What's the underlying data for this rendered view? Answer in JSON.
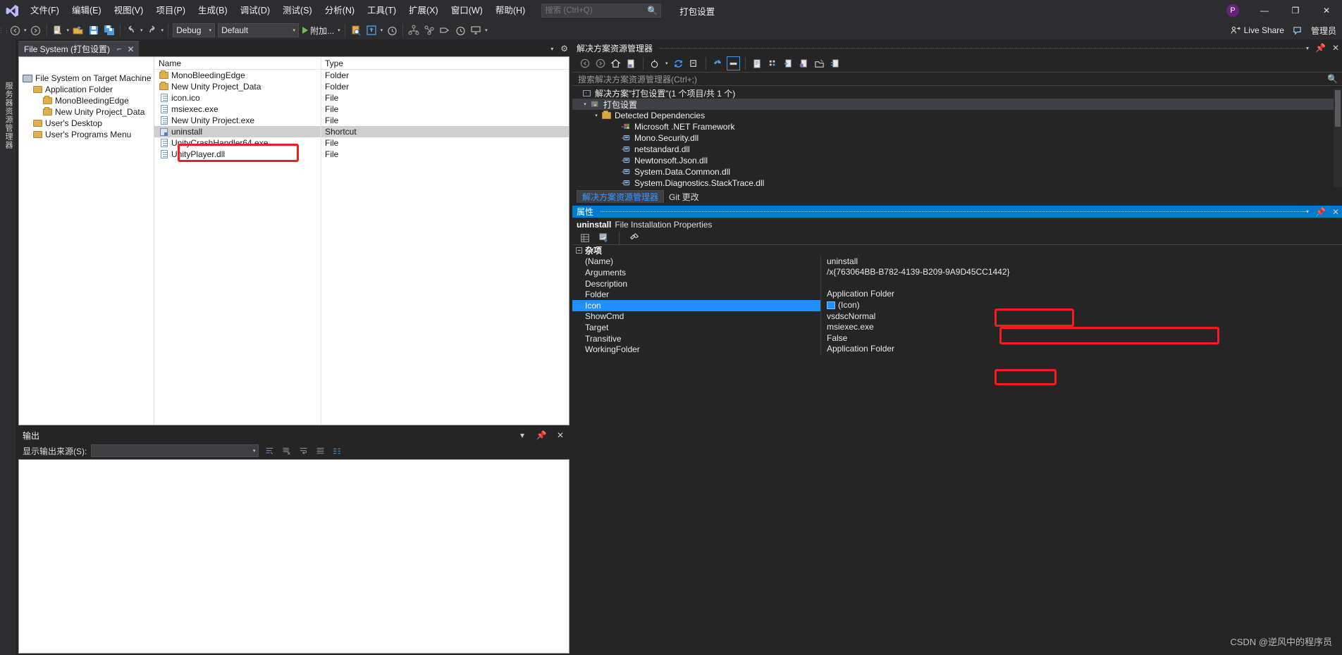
{
  "window": {
    "title": "打包设置",
    "account_initial": "P",
    "right_label": "管理员"
  },
  "menu": {
    "items": [
      "文件(F)",
      "编辑(E)",
      "视图(V)",
      "项目(P)",
      "生成(B)",
      "调试(D)",
      "测试(S)",
      "分析(N)",
      "工具(T)",
      "扩展(X)",
      "窗口(W)",
      "帮助(H)"
    ]
  },
  "quick_search": {
    "placeholder": "搜索 (Ctrl+Q)",
    "value": "",
    "icon": "magnifier-icon"
  },
  "titlebar_buttons": {
    "minimize": "—",
    "maximize": "❐",
    "close": "✕"
  },
  "toolbar": {
    "back_label": "◄",
    "forward_label": "►",
    "config_combo": "Debug",
    "platform_combo": "Default",
    "attach_label": "附加...",
    "live_share": "Live Share",
    "icons": [
      "navigate-back-icon",
      "navigate-forward-icon",
      "new-project-icon",
      "open-file-icon",
      "save-icon",
      "save-all-icon",
      "undo-icon",
      "redo-icon",
      "start-debug-icon",
      "find-in-files-icon",
      "hot-reload-icon",
      "timer-icon",
      "class-view-icon",
      "call-hierarchy-icon",
      "tag-icon",
      "history-icon",
      "stack-icon",
      "window-layout-icon"
    ]
  },
  "left_dock": {
    "vertical_tab": "服务器资源管理器"
  },
  "file_system_editor": {
    "tab_label": "File System (打包设置)",
    "tab_pin_icon": "pin-icon",
    "tab_close_icon": "close-icon",
    "tree": [
      {
        "label": "File System on Target Machine",
        "indent": 0,
        "icon": "computer-icon"
      },
      {
        "label": "Application Folder",
        "indent": 1,
        "icon": "folder-special-icon"
      },
      {
        "label": "MonoBleedingEdge",
        "indent": 2,
        "icon": "folder-icon"
      },
      {
        "label": "New Unity Project_Data",
        "indent": 2,
        "icon": "folder-icon"
      },
      {
        "label": "User's Desktop",
        "indent": 1,
        "icon": "folder-special-icon"
      },
      {
        "label": "User's Programs Menu",
        "indent": 1,
        "icon": "folder-special-icon"
      }
    ],
    "columns": [
      "Name",
      "Type"
    ],
    "rows": [
      {
        "name": "MonoBleedingEdge",
        "type": "Folder",
        "icon": "folder-icon",
        "selected": false
      },
      {
        "name": "New Unity Project_Data",
        "type": "Folder",
        "icon": "folder-icon",
        "selected": false
      },
      {
        "name": "icon.ico",
        "type": "File",
        "icon": "file-icon",
        "selected": false
      },
      {
        "name": "msiexec.exe",
        "type": "File",
        "icon": "file-icon",
        "selected": false
      },
      {
        "name": "New Unity Project.exe",
        "type": "File",
        "icon": "file-icon",
        "selected": false
      },
      {
        "name": "uninstall",
        "type": "Shortcut",
        "icon": "shortcut-icon",
        "selected": true
      },
      {
        "name": "UnityCrashHandler64.exe",
        "type": "File",
        "icon": "file-icon",
        "selected": false
      },
      {
        "name": "UnityPlayer.dll",
        "type": "File",
        "icon": "file-icon",
        "selected": false
      }
    ]
  },
  "output_window": {
    "title": "输出",
    "source_label": "显示输出来源(S):",
    "source_value": "",
    "icons": [
      "chevron-down-icon",
      "pin-icon",
      "close-icon",
      "find-message-icon",
      "clear-all-icon",
      "toggle-wordwrap-icon",
      "list-icon",
      "go-to-message-icon"
    ]
  },
  "solution_explorer": {
    "title": "解决方案资源管理器",
    "search_placeholder": "搜索解决方案资源管理器(Ctrl+;)",
    "toolbar_icons": [
      "back-icon",
      "forward-icon",
      "home-icon",
      "pending-changes-icon",
      "scope-icon",
      "refresh-icon",
      "collapse-all-icon",
      "properties-icon",
      "show-all-files-icon",
      "view-code-icon",
      "preview-selected-icon",
      "add-new-item-icon",
      "add-existing-item-icon",
      "new-folder-icon",
      "sync-views-icon"
    ],
    "tree": [
      {
        "label": "解决方案\"打包设置\"(1 个项目/共 1 个)",
        "indent": 0,
        "arrow": "",
        "icon": "solution-icon",
        "selected": false
      },
      {
        "label": "打包设置",
        "indent": 1,
        "arrow": "▾",
        "icon": "setup-project-icon",
        "selected": true
      },
      {
        "label": "Detected Dependencies",
        "indent": 2,
        "arrow": "▾",
        "icon": "folder-icon",
        "selected": false
      },
      {
        "label": "Microsoft .NET Framework",
        "indent": 3,
        "arrow": "",
        "icon": "framework-icon",
        "selected": false
      },
      {
        "label": "Mono.Security.dll",
        "indent": 3,
        "arrow": "",
        "icon": "assembly-icon",
        "selected": false
      },
      {
        "label": "netstandard.dll",
        "indent": 3,
        "arrow": "",
        "icon": "assembly-icon",
        "selected": false
      },
      {
        "label": "Newtonsoft.Json.dll",
        "indent": 3,
        "arrow": "",
        "icon": "assembly-icon",
        "selected": false
      },
      {
        "label": "System.Data.Common.dll",
        "indent": 3,
        "arrow": "",
        "icon": "assembly-icon",
        "selected": false
      },
      {
        "label": "System.Diagnostics.StackTrace.dll",
        "indent": 3,
        "arrow": "",
        "icon": "assembly-icon",
        "selected": false
      }
    ],
    "tabs": [
      {
        "label": "解决方案资源管理器",
        "active": true
      },
      {
        "label": "Git 更改",
        "active": false
      }
    ]
  },
  "properties_panel": {
    "title": "属性",
    "object_name": "uninstall",
    "object_type": "File Installation Properties",
    "toolbar_icons": [
      "categorized-icon",
      "alphabetical-icon",
      "properties-page-icon"
    ],
    "category": "杂项",
    "category_expander": "−",
    "rows": [
      {
        "name": "(Name)",
        "value": "uninstall",
        "selected": false
      },
      {
        "name": "Arguments",
        "value": "/x{763064BB-B782-4139-B209-9A9D45CC1442}",
        "selected": false
      },
      {
        "name": "Description",
        "value": "",
        "selected": false
      },
      {
        "name": "Folder",
        "value": "Application Folder",
        "selected": false
      },
      {
        "name": "Icon",
        "value": "(Icon)",
        "selected": true,
        "swatch": true
      },
      {
        "name": "ShowCmd",
        "value": "vsdscNormal",
        "selected": false
      },
      {
        "name": "Target",
        "value": "msiexec.exe",
        "selected": false
      },
      {
        "name": "Transitive",
        "value": "False",
        "selected": false
      },
      {
        "name": "WorkingFolder",
        "value": "Application Folder",
        "selected": false
      }
    ]
  },
  "annotations": {
    "color": "#f71c1c",
    "boxes": [
      "uninstall-file-row",
      "name-value",
      "arguments-value",
      "icon-value"
    ]
  },
  "watermark": "CSDN @逆风中的程序员"
}
